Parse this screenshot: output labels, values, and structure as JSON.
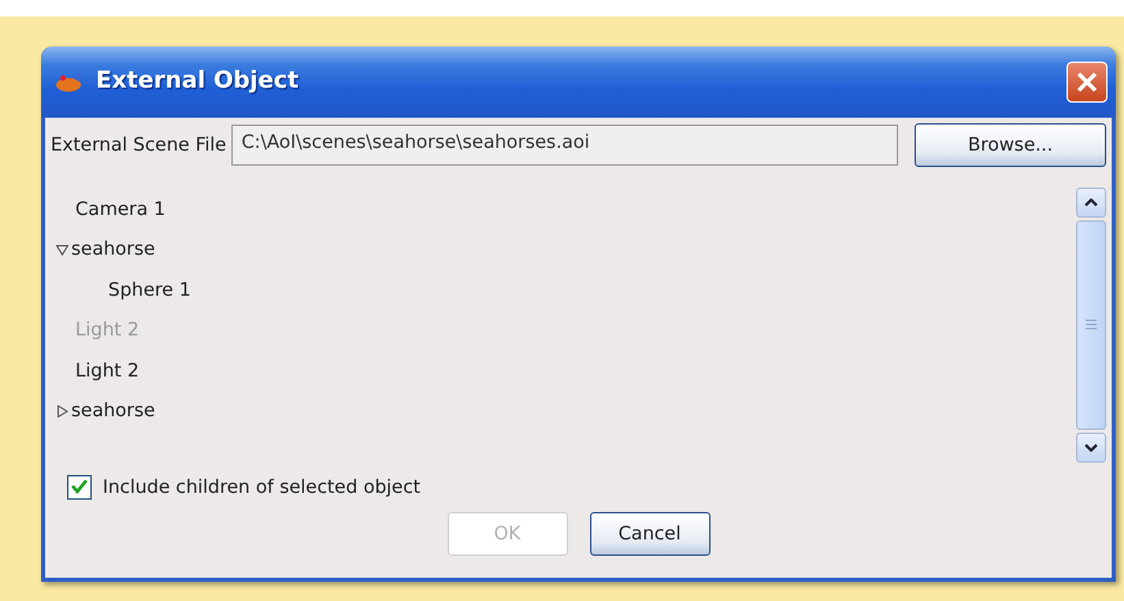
{
  "window": {
    "title": "External Object"
  },
  "scene_file": {
    "label": "External Scene File",
    "value": "C:\\AoI\\scenes\\seahorse\\seahorses.aoi",
    "browse_button": "Browse..."
  },
  "tree": [
    {
      "label": "Camera 1",
      "disabled": false
    },
    {
      "label": "seahorse",
      "expanded": true,
      "disabled": false,
      "children": [
        {
          "label": "Sphere 1",
          "disabled": false
        }
      ]
    },
    {
      "label": "Light 2",
      "disabled": true
    },
    {
      "label": "Light 2",
      "disabled": false
    },
    {
      "label": "seahorse",
      "expanded": false,
      "disabled": false
    }
  ],
  "include_children": {
    "label": "Include children of selected object",
    "checked": true
  },
  "buttons": [
    {
      "label": "OK",
      "disabled": true
    },
    {
      "label": "Cancel",
      "disabled": false
    }
  ]
}
